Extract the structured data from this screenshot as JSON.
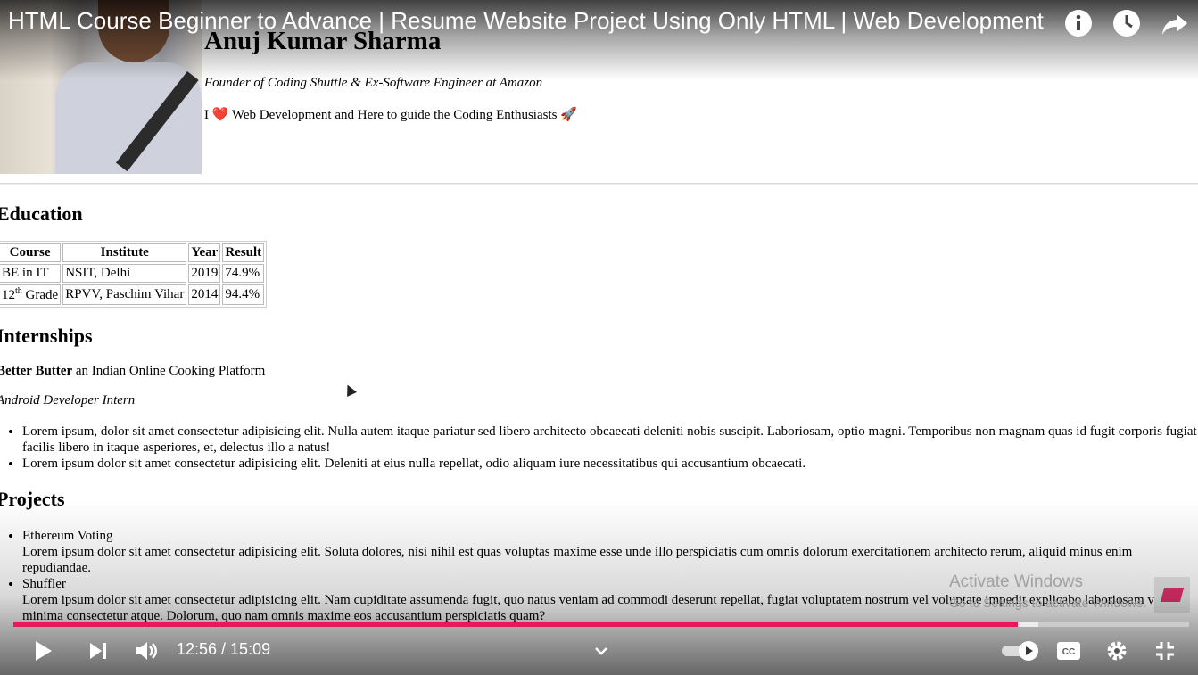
{
  "video": {
    "title": "HTML Course Beginner to Advance | Resume Website Project Using Only HTML | Web Development",
    "time_current": "12:56",
    "time_total": "15:09",
    "time_display": "12:56 / 15:09",
    "progress_fraction": 0.854,
    "buffered_fraction": 0.872,
    "accent_color": "#e8195b"
  },
  "resume": {
    "name": "Anuj Kumar Sharma",
    "tagline": "Founder of Coding Shuttle & Ex-Software Engineer at Amazon",
    "bio_prefix": "I ",
    "bio_heart": "❤️",
    "bio_text": " Web Development and Here to guide the Coding Enthusiasts ",
    "bio_rocket": "🚀",
    "education": {
      "heading": "Education",
      "columns": [
        "Course",
        "Institute",
        "Year",
        "Result"
      ],
      "rows": [
        {
          "course": "BE in IT",
          "institute": "NSIT, Delhi",
          "year": "2019",
          "result": "74.9%"
        },
        {
          "course_num": "12",
          "course_sup": "th",
          "course_rest": " Grade",
          "institute": "RPVV, Paschim Vihar",
          "year": "2014",
          "result": "94.4%"
        }
      ]
    },
    "internships": {
      "heading": "Internships",
      "company": "Better Butter",
      "company_desc": " an Indian Online Cooking Platform",
      "role": "Android Developer Intern",
      "points": [
        "Lorem ipsum, dolor sit amet consectetur adipisicing elit. Nulla autem itaque pariatur sed libero architecto obcaecati deleniti nobis suscipit. Laboriosam, optio magni. Temporibus non magnam quas id fugit corporis fugiat facilis libero in itaque asperiores, et, delectus illo a natus!",
        "Lorem ipsum dolor sit amet consectetur adipisicing elit. Deleniti at eius nulla repellat, odio aliquam iure necessitatibus qui accusantium obcaecati."
      ]
    },
    "projects": {
      "heading": "Projects",
      "items": [
        {
          "name": "Ethereum Voting",
          "desc": "Lorem ipsum dolor sit amet consectetur adipisicing elit. Soluta dolores, nisi nihil est quas voluptas maxime esse unde illo perspiciatis cum omnis dolorum exercitationem architecto rerum, aliquid minus enim repudiandae."
        },
        {
          "name": "Shuffler",
          "desc": "Lorem ipsum dolor sit amet consectetur adipisicing elit. Nam cupiditate assumenda fugit, quo natus veniam ad commodi deserunt repellat, fugiat voluptatem nostrum vel voluptate impedit explicabo laboriosam velit minima consectetur atque. Dolorum, quo nam omnis maxime eos accusantium perspiciatis quam?"
        }
      ]
    }
  },
  "watermark": {
    "line1": "Activate Windows",
    "line2": "Go to Settings to activate Windows."
  },
  "icons": {
    "info": "info-icon",
    "watch_later": "clock-icon",
    "share": "share-icon",
    "play": "play-icon",
    "next": "next-icon",
    "volume": "volume-icon",
    "chevron": "chevron-down-icon",
    "autoplay": "autoplay-toggle-icon",
    "captions": "captions-icon",
    "settings": "gear-icon",
    "exit_fullscreen": "exit-fullscreen-icon"
  }
}
